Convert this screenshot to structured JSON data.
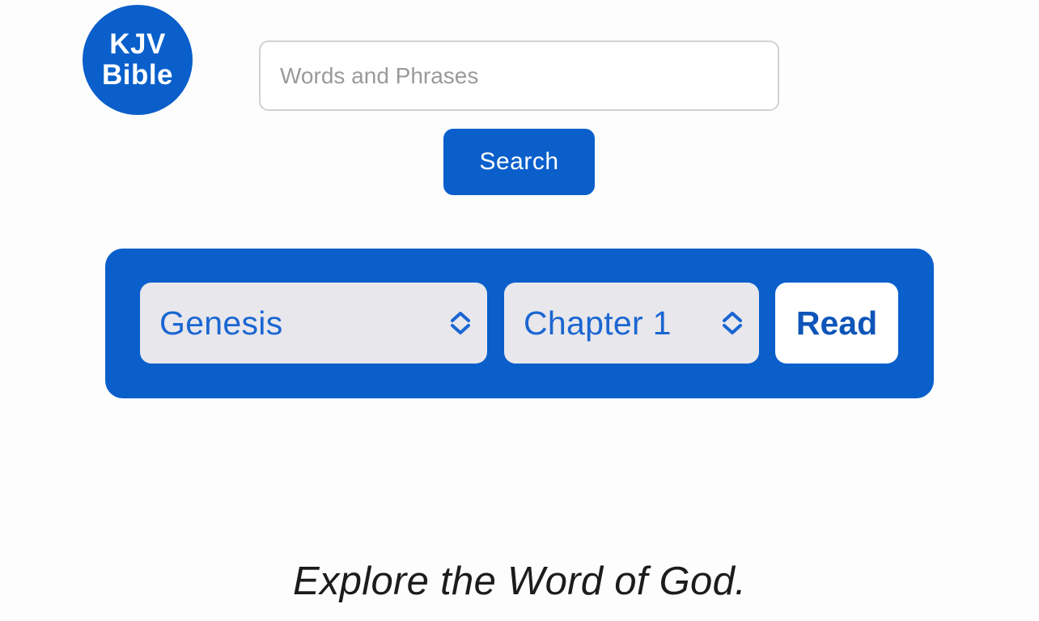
{
  "logo": {
    "line1": "KJV",
    "line2": "Bible"
  },
  "search": {
    "placeholder": "Words and Phrases",
    "value": "",
    "button_label": "Search"
  },
  "navigator": {
    "book_selected": "Genesis",
    "chapter_selected": "Chapter 1",
    "read_label": "Read"
  },
  "tagline": "Explore the Word of God.",
  "colors": {
    "brand_blue": "#0a5fcb",
    "select_bg": "#e8e7ec",
    "select_text": "#1a66d2"
  },
  "icons": {
    "select_chevron": "chevron-up-down-icon"
  }
}
